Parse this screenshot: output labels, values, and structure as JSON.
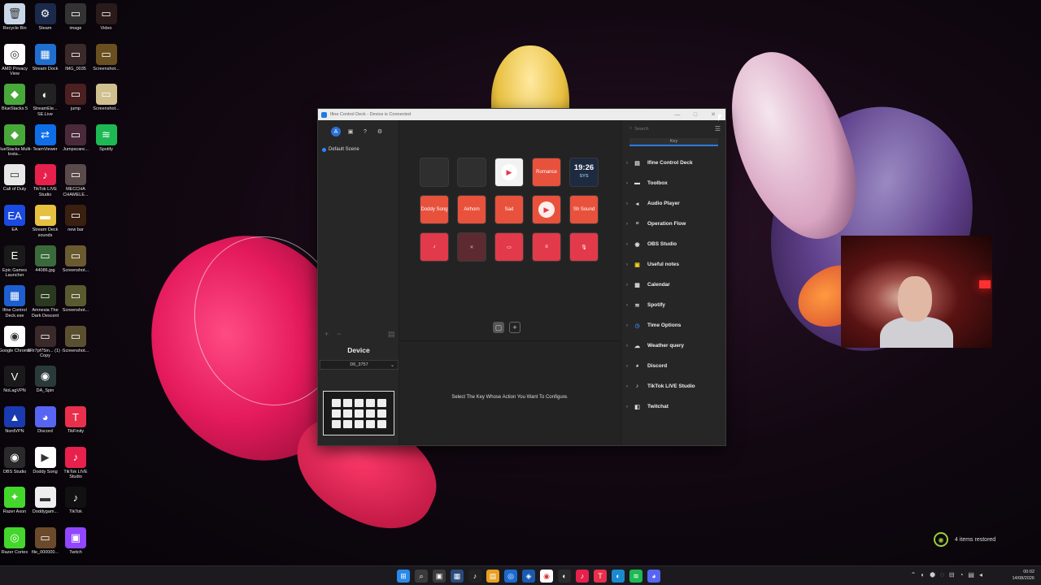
{
  "desktop": {
    "icons": [
      {
        "label": "Recycle Bin",
        "color": "#c9d6e8",
        "glyph": "🗑"
      },
      {
        "label": "Steam",
        "color": "#1b2a4a",
        "glyph": "⚙"
      },
      {
        "label": "image",
        "color": "#333333",
        "glyph": "▭"
      },
      {
        "label": "Video",
        "color": "#2a1a1a",
        "glyph": "▭"
      },
      {
        "label": "AMD Privacy View",
        "color": "#ffffff",
        "glyph": "◎"
      },
      {
        "label": "Stream Dock",
        "color": "#1f6fd0",
        "glyph": "▦"
      },
      {
        "label": "IMG_0035",
        "color": "#3a2a2a",
        "glyph": "▭"
      },
      {
        "label": "Screenshot...",
        "color": "#6a5020",
        "glyph": "▭"
      },
      {
        "label": "BlueStacks 5",
        "color": "#49a83a",
        "glyph": "◆"
      },
      {
        "label": "StreamEle... SE.Live",
        "color": "#222222",
        "glyph": "◐"
      },
      {
        "label": "jump",
        "color": "#4a2020",
        "glyph": "▭"
      },
      {
        "label": "Screenshot...",
        "color": "#d0c090",
        "glyph": "▭"
      },
      {
        "label": "BlueStacks Multi-Insta...",
        "color": "#49a83a",
        "glyph": "◆"
      },
      {
        "label": "TeamViewer",
        "color": "#0e6ee8",
        "glyph": "⇄"
      },
      {
        "label": "Jumpscare...",
        "color": "#4a2a3a",
        "glyph": "▭"
      },
      {
        "label": "Spotify",
        "color": "#1db954",
        "glyph": "≋"
      },
      {
        "label": "Call of Duty",
        "color": "#e8e8e8",
        "glyph": "▭"
      },
      {
        "label": "TikTok LIVE Studio",
        "color": "#e8204c",
        "glyph": "♪"
      },
      {
        "label": "MECCHA CHAMELE...",
        "color": "#5a4a4a",
        "glyph": "▭"
      },
      {
        "label": "",
        "color": "transparent",
        "glyph": ""
      },
      {
        "label": "EA",
        "color": "#1a4adf",
        "glyph": "EA"
      },
      {
        "label": "Stream Deck sounds",
        "color": "#e8c040",
        "glyph": "▬"
      },
      {
        "label": "new bar",
        "color": "#3a2010",
        "glyph": "▭"
      },
      {
        "label": "",
        "color": "transparent",
        "glyph": ""
      },
      {
        "label": "Epic Games Launcher",
        "color": "#1a1a1a",
        "glyph": "E"
      },
      {
        "label": "44086.jpg",
        "color": "#3a6a3a",
        "glyph": "▭"
      },
      {
        "label": "Screenshot...",
        "color": "#6a5a30",
        "glyph": "▭"
      },
      {
        "label": "",
        "color": "transparent",
        "glyph": ""
      },
      {
        "label": "Ifine Control Deck.exe",
        "color": "#1e5fd0",
        "glyph": "▦"
      },
      {
        "label": "Amnesia The Dark Descent",
        "color": "#2a3a20",
        "glyph": "▭"
      },
      {
        "label": "Screenshot...",
        "color": "#5a5a30",
        "glyph": "▭"
      },
      {
        "label": "",
        "color": "transparent",
        "glyph": ""
      },
      {
        "label": "Google Chrome",
        "color": "#ffffff",
        "glyph": "◉"
      },
      {
        "label": "8Rr7pf75m... (1) - Copy",
        "color": "#3a2a2a",
        "glyph": "▭"
      },
      {
        "label": "Screenshot...",
        "color": "#5a5030",
        "glyph": "▭"
      },
      {
        "label": "",
        "color": "transparent",
        "glyph": ""
      },
      {
        "label": "NoLagVPN",
        "color": "#1a1a1a",
        "glyph": "V"
      },
      {
        "label": "DA_Spin",
        "color": "#2a3a3a",
        "glyph": "◉"
      },
      {
        "label": "",
        "color": "transparent",
        "glyph": ""
      },
      {
        "label": "",
        "color": "transparent",
        "glyph": ""
      },
      {
        "label": "NordVPN",
        "color": "#1a3ab0",
        "glyph": "▲"
      },
      {
        "label": "Discord",
        "color": "#5865f2",
        "glyph": "◕"
      },
      {
        "label": "TikFinity",
        "color": "#e8304c",
        "glyph": "T"
      },
      {
        "label": "",
        "color": "transparent",
        "glyph": ""
      },
      {
        "label": "OBS Studio",
        "color": "#2a2a2a",
        "glyph": "◉"
      },
      {
        "label": "Doddy Song",
        "color": "#ffffff",
        "glyph": "▶"
      },
      {
        "label": "TikTok LIVE Studio",
        "color": "#e8204c",
        "glyph": "♪"
      },
      {
        "label": "",
        "color": "transparent",
        "glyph": ""
      },
      {
        "label": "Razer Axon",
        "color": "#44d62c",
        "glyph": "✦"
      },
      {
        "label": "Doddygam...",
        "color": "#eeeeee",
        "glyph": "▬"
      },
      {
        "label": "TikTok",
        "color": "#111111",
        "glyph": "♪"
      },
      {
        "label": "",
        "color": "transparent",
        "glyph": ""
      },
      {
        "label": "Razer Cortex",
        "color": "#44d62c",
        "glyph": "◎"
      },
      {
        "label": "file_000000...",
        "color": "#6a4a2a",
        "glyph": "▭"
      },
      {
        "label": "Twitch",
        "color": "#9146ff",
        "glyph": "▣"
      }
    ]
  },
  "window": {
    "title": "Ifine Control Deck - Device is Connected",
    "minimize": "—",
    "maximize": "□",
    "close": "✕",
    "toolbar_icons": [
      "A",
      "▣",
      "?",
      "⚙"
    ],
    "scene_name": "Default Scene",
    "add_label": "+",
    "remove_label": "−",
    "trash_label": "▤",
    "device_title": "Device",
    "device_select": "D6_3757",
    "page_prev": "▢",
    "page_add": "+",
    "hint_text": "Select The Key Whose Action You Want To Configure.",
    "search_placeholder": "Search",
    "key_tab": "Key",
    "keys": [
      {
        "style": "blank",
        "text": ""
      },
      {
        "style": "blank",
        "text": ""
      },
      {
        "style": "white",
        "text": "▶"
      },
      {
        "style": "orange",
        "text": "Romance"
      },
      {
        "style": "dark",
        "text": "19:26",
        "sub": "SYS"
      },
      {
        "style": "orange",
        "text": "Doddy Song"
      },
      {
        "style": "orange",
        "text": "Airhorn"
      },
      {
        "style": "orange",
        "text": "Sad"
      },
      {
        "style": "orange",
        "text": "▶"
      },
      {
        "style": "orange",
        "text": "Sh Sound"
      },
      {
        "style": "red",
        "text": "♪"
      },
      {
        "style": "muted",
        "text": "✕"
      },
      {
        "style": "red",
        "text": "▭"
      },
      {
        "style": "red",
        "text": "≡"
      },
      {
        "style": "red",
        "text": "🎙"
      }
    ],
    "plugins": [
      {
        "name": "Ifine Control Deck",
        "icon": "▤",
        "color": "#dddddd"
      },
      {
        "name": "Toolbox",
        "icon": "▬",
        "color": "#dddddd"
      },
      {
        "name": "Audio Player",
        "icon": "◂",
        "color": "#dddddd"
      },
      {
        "name": "Operation Flow",
        "icon": "≡",
        "color": "#dddddd"
      },
      {
        "name": "OBS Studio",
        "icon": "◉",
        "color": "#dddddd"
      },
      {
        "name": "Useful notes",
        "icon": "▣",
        "color": "#f0d020"
      },
      {
        "name": "Calendar",
        "icon": "▦",
        "color": "#dddddd"
      },
      {
        "name": "Spotify",
        "icon": "≋",
        "color": "#dddddd"
      },
      {
        "name": "Time Options",
        "icon": "◷",
        "color": "#3a7be0"
      },
      {
        "name": "Weather query",
        "icon": "☁",
        "color": "#dddddd"
      },
      {
        "name": "Discord",
        "icon": "◕",
        "color": "#dddddd"
      },
      {
        "name": "TikTok LIVE Studio",
        "icon": "♪",
        "color": "#dddddd"
      },
      {
        "name": "Twitchat",
        "icon": "◧",
        "color": "#dddddd"
      }
    ]
  },
  "notification": {
    "text": "4 items restored",
    "icon": "◉"
  },
  "taskbar": {
    "apps": [
      {
        "glyph": "⊞",
        "color": "#2a8ae8"
      },
      {
        "glyph": "⌕",
        "color": "#3a3a3a"
      },
      {
        "glyph": "▣",
        "color": "#3a3a3a"
      },
      {
        "glyph": "▦",
        "color": "#2a4a7a"
      },
      {
        "glyph": "♪",
        "color": "#222222"
      },
      {
        "glyph": "▤",
        "color": "#e8a020"
      },
      {
        "glyph": "◎",
        "color": "#1a6ad0"
      },
      {
        "glyph": "◈",
        "color": "#1a5ab0"
      },
      {
        "glyph": "◉",
        "color": "#ffffff"
      },
      {
        "glyph": "◐",
        "color": "#2a2a2a"
      },
      {
        "glyph": "♪",
        "color": "#e8204c"
      },
      {
        "glyph": "T",
        "color": "#e8304c"
      },
      {
        "glyph": "◐",
        "color": "#1a8ad0"
      },
      {
        "glyph": "≋",
        "color": "#1db954"
      },
      {
        "glyph": "◕",
        "color": "#5865f2"
      }
    ],
    "tray": [
      "⌃",
      "◐",
      "⬢",
      "◌",
      "⊟",
      "◔",
      "▤",
      "◂"
    ],
    "time": "00:02",
    "date": "14/08/2026"
  }
}
